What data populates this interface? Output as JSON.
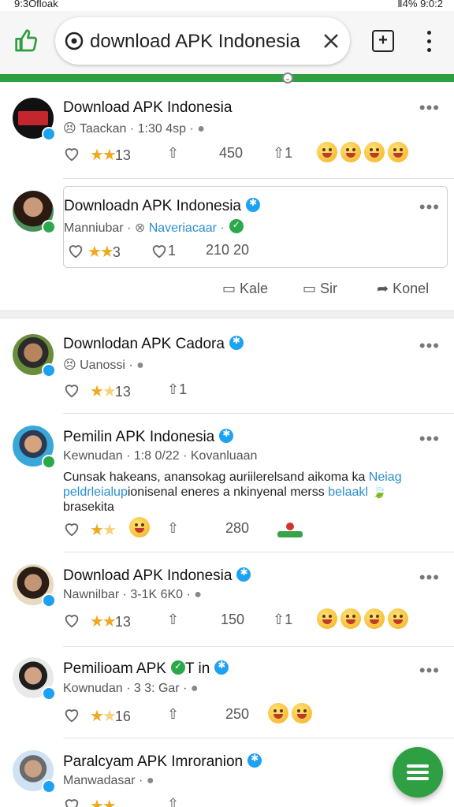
{
  "status_bar": {
    "left": "9:3Ofloak",
    "right": "Ⅱ4% 9:0:2"
  },
  "toolbar": {
    "url": "download APK Indonesia"
  },
  "posts": [
    {
      "name": "Download APK Indonesia",
      "meta": "Taackan · 1:30 4sp ·",
      "rating": "13",
      "count": "450",
      "share": "1",
      "emojis": 4
    },
    {
      "name": "Downloadn APK Indonesia",
      "meta_a": "Manniubar ·",
      "meta_link": "Naveriacaar ·",
      "rating": "3",
      "likes": "1",
      "count": "210 20"
    },
    {
      "name": "Downlodan APK Cadora",
      "meta": "Uanossi ·",
      "rating": "13",
      "share": "1"
    },
    {
      "name": "Pemilin APK Indonesia",
      "meta": "Kewnudan · 1:8 0/22 · Kovanluaan",
      "body_a": "Cunsak hakeans, anansokag auriilerelsand aikoma ka",
      "body_link_a": "Neiag",
      "body_link_b": "peldrleialup",
      "body_b": "ionisenal eneres a nkinyenal merss",
      "body_link_c": "belaakl",
      "body_c": "brasekita",
      "count": "280"
    },
    {
      "name": "Download APK Indonesia",
      "meta": "Nawnilbar · 3-1K 6K0 ·",
      "rating": "13",
      "count": "150",
      "share": "1",
      "emojis": 4
    },
    {
      "name": "Pemilioam APK",
      "name_tail": "T in",
      "meta": "Kownudan · 3 3: Gar ·",
      "rating": "16",
      "count": "250"
    },
    {
      "name": "Paralcyam APK Imroranion",
      "meta": "Manwadasar ·"
    }
  ],
  "share_row": {
    "comment": "Kale",
    "reply": "Sir",
    "share": "Konel"
  },
  "icons": [
    "thumbs-up-icon",
    "target-icon",
    "close-icon",
    "tabs-icon",
    "more-vert-icon",
    "heart-icon",
    "star-icon",
    "share-icon",
    "comment-icon",
    "fab-menu-icon"
  ],
  "colors": {
    "accent_green": "#2e9e3e",
    "verified_blue": "#1da1f2",
    "link": "#2b8fd0",
    "star": "#f0a81e"
  }
}
